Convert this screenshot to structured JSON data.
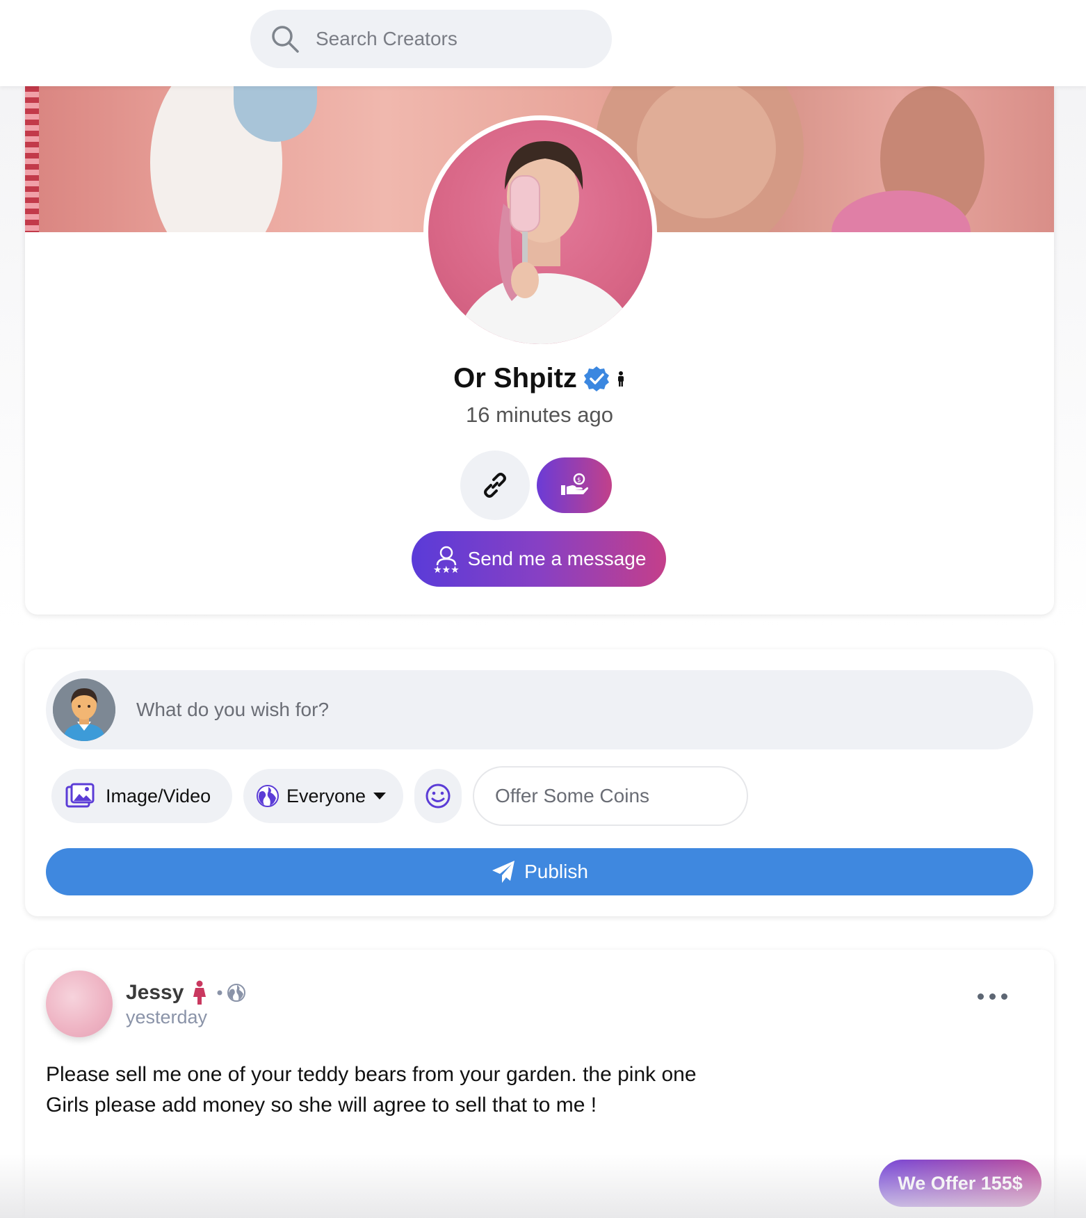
{
  "search": {
    "placeholder": "Search Creators"
  },
  "profile": {
    "name": "Or Shpitz",
    "time": "16 minutes ago",
    "message_button": "Send me a message"
  },
  "composer": {
    "wish_placeholder": "What do you wish for?",
    "media_label": "Image/Video",
    "audience_label": "Everyone",
    "coins_placeholder": "Offer Some Coins",
    "publish_label": "Publish"
  },
  "post": {
    "author": "Jessy",
    "time": "yesterday",
    "text_line1": "Please sell me one of your teddy bears from your garden. the pink one",
    "text_line2": "Girls please add money so she will agree to sell that to me !",
    "offer_label": "We Offer 155$"
  },
  "colors": {
    "accent_gradient_start": "#5a3bd8",
    "accent_gradient_end": "#c43f8a",
    "publish_blue": "#3f88df",
    "verified_blue": "#3b87e0"
  },
  "icons": [
    "search-icon",
    "verified-badge-icon",
    "male-icon",
    "link-icon",
    "hand-coin-icon",
    "users-stars-icon",
    "gallery-icon",
    "globe-icon",
    "caret-down-icon",
    "smiley-icon",
    "paper-plane-icon",
    "female-icon",
    "more-icon"
  ]
}
